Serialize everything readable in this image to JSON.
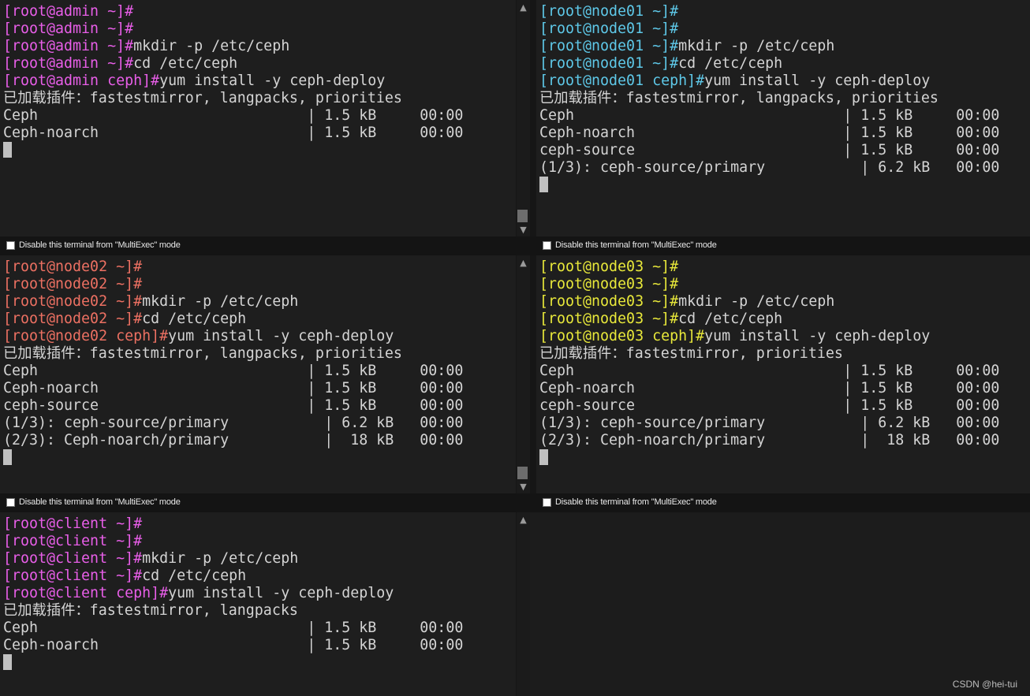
{
  "colors": {
    "admin": "#e85ee8",
    "node01": "#5ec8e8",
    "node02": "#ec7062",
    "node03": "#e8e83a",
    "client": "#e85ee8",
    "text": "#d4d4d4",
    "background": "#1e1e1e"
  },
  "icons": {
    "scroll_up": "▲",
    "scroll_down": "▼",
    "scroll_up_name": "chevron-up-icon",
    "scroll_down_name": "chevron-down-icon"
  },
  "multiexec_label": "Disable this terminal from \"MultiExec\" mode",
  "watermark": "CSDN @hei-tui",
  "terminals": {
    "admin": {
      "prompts": [
        "[root@admin ~]#",
        "[root@admin ~]#",
        "[root@admin ~]#",
        "[root@admin ~]#",
        "[root@admin ceph]#"
      ],
      "commands": [
        "",
        "",
        "mkdir -p /etc/ceph",
        "cd /etc/ceph",
        "yum install -y ceph-deploy"
      ],
      "output": [
        "已加载插件：fastestmirror, langpacks, priorities",
        "Ceph                               | 1.5 kB     00:00",
        "Ceph-noarch                        | 1.5 kB     00:00"
      ]
    },
    "node01": {
      "prompts": [
        "[root@node01 ~]#",
        "[root@node01 ~]#",
        "[root@node01 ~]#",
        "[root@node01 ~]#",
        "[root@node01 ceph]#"
      ],
      "commands": [
        "",
        "",
        "mkdir -p /etc/ceph",
        "cd /etc/ceph",
        "yum install -y ceph-deploy"
      ],
      "output": [
        "已加载插件：fastestmirror, langpacks, priorities",
        "Ceph                               | 1.5 kB     00:00",
        "Ceph-noarch                        | 1.5 kB     00:00",
        "ceph-source                        | 1.5 kB     00:00",
        "(1/3): ceph-source/primary           | 6.2 kB   00:00"
      ]
    },
    "node02": {
      "prompts": [
        "[root@node02 ~]#",
        "[root@node02 ~]#",
        "[root@node02 ~]#",
        "[root@node02 ~]#",
        "[root@node02 ceph]#"
      ],
      "commands": [
        "",
        "",
        "mkdir -p /etc/ceph",
        "cd /etc/ceph",
        "yum install -y ceph-deploy"
      ],
      "output": [
        "已加载插件：fastestmirror, langpacks, priorities",
        "Ceph                               | 1.5 kB     00:00",
        "Ceph-noarch                        | 1.5 kB     00:00",
        "ceph-source                        | 1.5 kB     00:00",
        "(1/3): ceph-source/primary           | 6.2 kB   00:00",
        "(2/3): Ceph-noarch/primary           |  18 kB   00:00"
      ]
    },
    "node03": {
      "prompts": [
        "[root@node03 ~]#",
        "[root@node03 ~]#",
        "[root@node03 ~]#",
        "[root@node03 ~]#",
        "[root@node03 ceph]#"
      ],
      "commands": [
        "",
        "",
        "mkdir -p /etc/ceph",
        "cd /etc/ceph",
        "yum install -y ceph-deploy"
      ],
      "output": [
        "已加载插件：fastestmirror, priorities",
        "Ceph                               | 1.5 kB     00:00",
        "Ceph-noarch                        | 1.5 kB     00:00",
        "ceph-source                        | 1.5 kB     00:00",
        "(1/3): ceph-source/primary           | 6.2 kB   00:00",
        "(2/3): Ceph-noarch/primary           |  18 kB   00:00"
      ]
    },
    "client": {
      "prompts": [
        "[root@client ~]#",
        "[root@client ~]#",
        "[root@client ~]#",
        "[root@client ~]#",
        "[root@client ceph]#"
      ],
      "commands": [
        "",
        "",
        "mkdir -p /etc/ceph",
        "cd /etc/ceph",
        "yum install -y ceph-deploy"
      ],
      "output": [
        "已加载插件：fastestmirror, langpacks",
        "Ceph                               | 1.5 kB     00:00",
        "Ceph-noarch                        | 1.5 kB     00:00"
      ]
    }
  }
}
